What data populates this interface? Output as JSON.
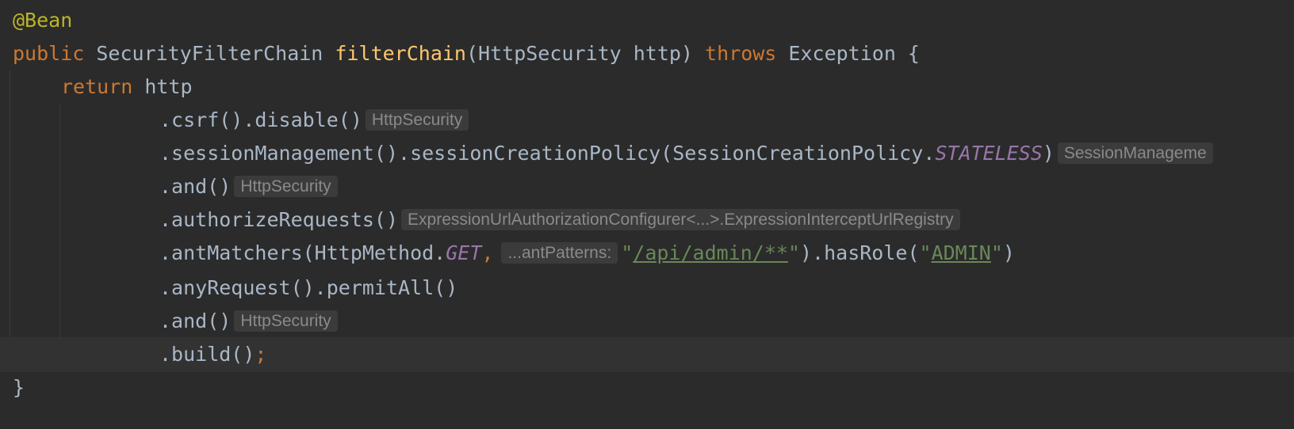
{
  "code": {
    "annotation": "@Bean",
    "line2": {
      "kw_public": "public",
      "return_type": "SecurityFilterChain",
      "method_name": "filterChain",
      "params": "(HttpSecurity http)",
      "kw_throws": "throws",
      "exception": "Exception {"
    },
    "line3": {
      "kw_return": "return",
      "target": "http"
    },
    "chain": [
      {
        "code": ".csrf().disable()",
        "hint": "HttpSecurity"
      },
      {
        "code_pre": ".sessionManagement().sessionCreationPolicy(SessionCreationPolicy.",
        "constant": "STATELESS",
        "code_post": ")",
        "hint": "SessionManageme"
      },
      {
        "code": ".and()",
        "hint": "HttpSecurity"
      },
      {
        "code": ".authorizeRequests()",
        "hint": "ExpressionUrlAuthorizationConfigurer<...>.ExpressionInterceptUrlRegistry"
      },
      {
        "code_pre": ".antMatchers(HttpMethod.",
        "constant": "GET",
        "comma": ",",
        "param_hint": "...antPatterns:",
        "quote_open": "\"",
        "path_string": "/api/admin/**",
        "quote_close": "\"",
        "mid": ").hasRole(",
        "role_quote_open": "\"",
        "role_string": "ADMIN",
        "role_quote_close": "\"",
        "end": ")"
      },
      {
        "code": ".anyRequest().permitAll()"
      },
      {
        "code": ".and()",
        "hint": "HttpSecurity"
      },
      {
        "code": ".build()",
        "semicolon": ";"
      }
    ],
    "closing_brace": "}"
  }
}
